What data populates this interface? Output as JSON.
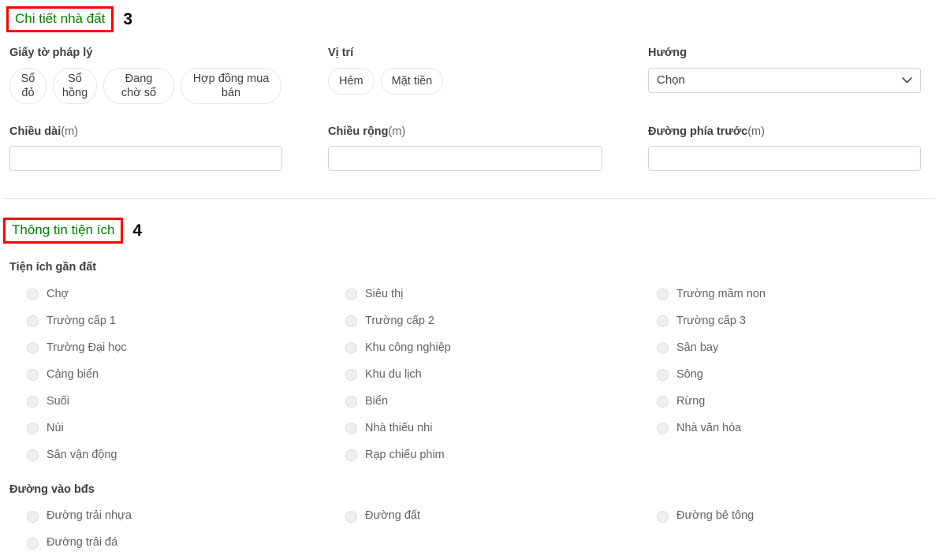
{
  "section_detail": {
    "title": "Chi tiết nhà đất",
    "step": "3",
    "legal_docs": {
      "label": "Giấy tờ pháp lý",
      "options": [
        "Sổ đỏ",
        "Sổ hồng",
        "Đang chờ sổ",
        "Hợp đồng mua bán"
      ]
    },
    "position": {
      "label": "Vị trí",
      "options": [
        "Hẻm",
        "Mặt tiền"
      ]
    },
    "direction": {
      "label": "Hướng",
      "selected": "Chọn",
      "chevron_icon": "chevron-down-icon"
    },
    "length": {
      "label_main": "Chiều dài",
      "label_unit": "(m)",
      "value": "",
      "placeholder": ""
    },
    "width": {
      "label_main": "Chiều rộng",
      "label_unit": "(m)",
      "value": "",
      "placeholder": ""
    },
    "front_road": {
      "label_main": "Đường phía trước",
      "label_unit": "(m)",
      "value": "",
      "placeholder": ""
    }
  },
  "section_amenities": {
    "title": "Thông tin tiện ích",
    "step": "4",
    "nearby": {
      "label": "Tiện ích gần đất",
      "column1": [
        "Chợ",
        "Trường cấp 1",
        "Trường Đại học",
        "Cảng biển",
        "Suối",
        "Núi",
        "Sân vận động"
      ],
      "column2": [
        "Siêu thị",
        "Trường cấp 2",
        "Khu công nghiệp",
        "Khu du lịch",
        "Biển",
        "Nhà thiếu nhi",
        "Rạp chiếu phim"
      ],
      "column3": [
        "Trường mầm non",
        "Trường cấp 3",
        "Sân bay",
        "Sông",
        "Rừng",
        "Nhà văn hóa"
      ]
    },
    "access_road": {
      "label": "Đường vào bđs",
      "column1": [
        "Đường trải nhựa",
        "Đường trải đá"
      ],
      "column2": [
        "Đường đất"
      ],
      "column3": [
        "Đường bê tông"
      ]
    }
  },
  "colors": {
    "section_title_green": "#008000",
    "annotation_red": "#ff0000",
    "text_primary": "#3c4043",
    "text_secondary": "#5f6368",
    "border_light": "#e3e5e8",
    "input_border": "#ccd4e0"
  }
}
